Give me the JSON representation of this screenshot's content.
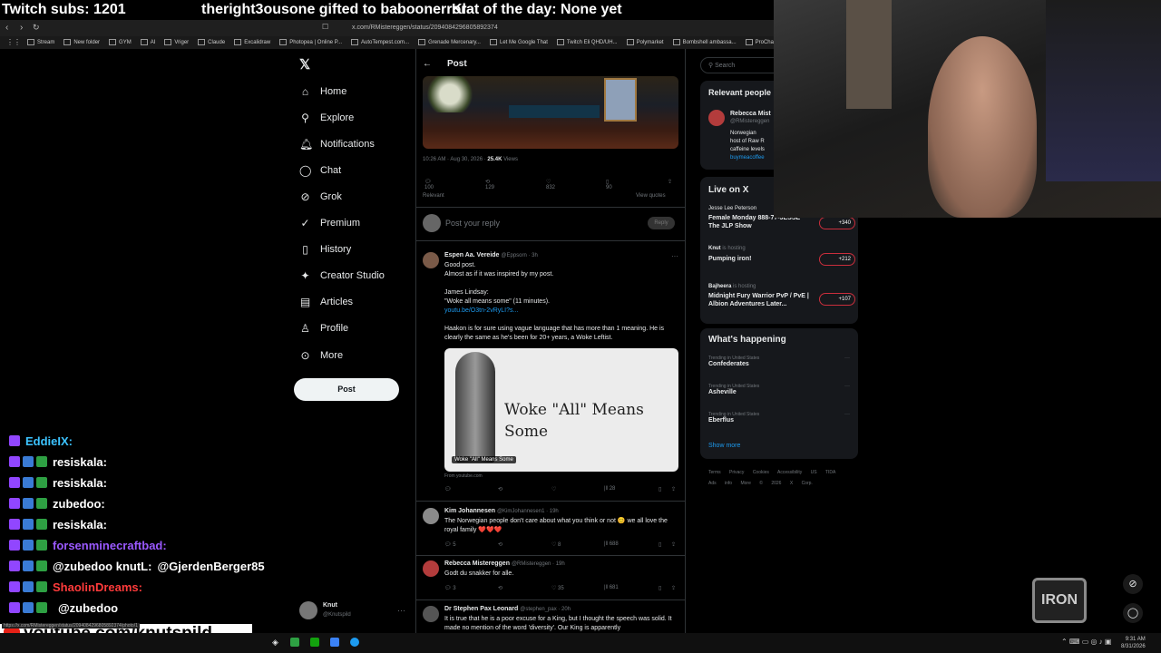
{
  "overlay": {
    "subs": "Twitch subs: 1201",
    "gift": "theright3ousone gifted to baboonerror",
    "klat": "Klat of the day: None yet"
  },
  "browser": {
    "url": "x.com/RMistereggen/status/2094084296805892374",
    "bookmarks": [
      "Stream",
      "New folder",
      "GYM",
      "AI",
      "Vriger",
      "Claude",
      "Excalidraw",
      "Photopea | Online P...",
      "AutoTempest.com...",
      "Grenade Mercenary...",
      "Let Me Google That",
      "Twitch Eli QHD/UH...",
      "Polymarket",
      "Bombshell ambassa...",
      "ProChat - The"
    ]
  },
  "nav": {
    "home": "Home",
    "explore": "Explore",
    "notifications": "Notifications",
    "chat": "Chat",
    "grok": "Grok",
    "premium": "Premium",
    "history": "History",
    "creator_studio": "Creator Studio",
    "articles": "Articles",
    "profile": "Profile",
    "more": "More",
    "post": "Post"
  },
  "account": {
    "name": "Knut",
    "handle": "@Knutspild"
  },
  "header": {
    "title": "Post",
    "search_placeholder": "Search"
  },
  "post": {
    "timestamp": "10:26 AM · Aug 30, 2026 ·",
    "views_count": "25.4K",
    "views_label": "Views",
    "replies": "100",
    "reposts": "129",
    "likes": "832",
    "bookmarks": "90",
    "relevant": "Relevant",
    "view_quotes": "View quotes",
    "reply_placeholder": "Post your reply",
    "reply_btn": "Reply"
  },
  "replies": [
    {
      "name": "Espen Aa. Vereide",
      "handle": "@Eppsorn · 3h",
      "lines": [
        "Good post.",
        "Almost as if it was inspired by my post.",
        "",
        "James Lindsay:",
        "\"Woke all means some\" (11 minutes)."
      ],
      "link": "youtu.be/O3tn-2vRyLI?s...",
      "extra": "Haakon is for sure using vague language that has more than 1 meaning. He is clearly the same as he's been for 20+ years, a Woke Leftist.",
      "card_title": "Woke \"All\" Means Some",
      "card_caption": "Woke \"All\" Means Some",
      "card_source": "From youtube.com",
      "stats": {
        "views": "28"
      }
    },
    {
      "name": "Kim Johannesen",
      "handle": "@KimJohannesen1 · 19h",
      "text": "The Norwegian people don't care about what you think or not 😊 we all love the royal family ❤️❤️❤️",
      "stats": {
        "replies": "5",
        "likes": "8",
        "views": "688"
      }
    },
    {
      "name": "Rebecca Mistereggen",
      "handle": "@RMistereggen · 19h",
      "text": "Godt du snakker for alle.",
      "stats": {
        "replies": "3",
        "likes": "35",
        "views": "681"
      }
    },
    {
      "name": "Dr Stephen Pax Leonard",
      "handle": "@stephen_pax · 20h",
      "text": "It is true that he is a poor excuse for a King, but I thought the speech was solid. It made no mention of the word 'diversity'. Our King is apparently"
    }
  ],
  "right": {
    "relevant_title": "Relevant people",
    "person_name": "Rebecca Mist",
    "person_handle": "@RMistereggen",
    "person_bio": [
      "Norwegian",
      "host of Raw R",
      "caffeine levels",
      "buymeacoffee"
    ],
    "live_title": "Live on X",
    "live": [
      {
        "host": "Jesse Lee Peterson",
        "title": "Female Monday 888-77-JESSE The JLP Show",
        "count": "+340"
      },
      {
        "host": "Knut",
        "title": "Pumping iron!",
        "count": "+212",
        "status": "is hosting"
      },
      {
        "host": "Bajheera",
        "title": "Midnight Fury Warrior PvP / PvE | Albion Adventures Later...",
        "count": "+107",
        "status": "is hosting"
      }
    ],
    "happening_title": "What's happening",
    "trends": [
      {
        "label": "Trending in United States",
        "name": "Confederates"
      },
      {
        "label": "Trending in United States",
        "name": "Asheville"
      },
      {
        "label": "Trending in United States",
        "name": "Eberflus"
      }
    ],
    "show_more": "Show more",
    "footer": [
      "Terms",
      "Privacy",
      "Cookies",
      "Accessibility",
      "US TIDA",
      "Ads info",
      "More",
      "© 2026 X Corp."
    ]
  },
  "chat": [
    {
      "user": "EddieIX:",
      "color": "#3cc3ff",
      "msg": ""
    },
    {
      "user": "resiskala:",
      "color": "#ffffff",
      "msg": ""
    },
    {
      "user": "resiskala:",
      "color": "#ffffff",
      "msg": ""
    },
    {
      "user": "zubedoo:",
      "color": "#ffffff",
      "msg": ""
    },
    {
      "user": "resiskala:",
      "color": "#ffffff",
      "msg": ""
    },
    {
      "user": "forsenminecraftbad:",
      "color": "#9b59ff",
      "msg": ""
    },
    {
      "user": "@zubedoo knutL:",
      "color": "#ffffff",
      "msg": "@GjerdenBerger85"
    },
    {
      "user": "ShaolinDreams:",
      "color": "#ff3b3b",
      "msg": ""
    },
    {
      "user": "",
      "color": "#ffffff",
      "msg": "@zubedoo"
    }
  ],
  "banner": "youtube.com/knutspild",
  "statusbar_url": "https://x.com/RMistereggen/status/2094084296805892374/photo/1",
  "clock": {
    "time": "9:31 AM",
    "date": "8/31/2026"
  },
  "logo": "IRON"
}
